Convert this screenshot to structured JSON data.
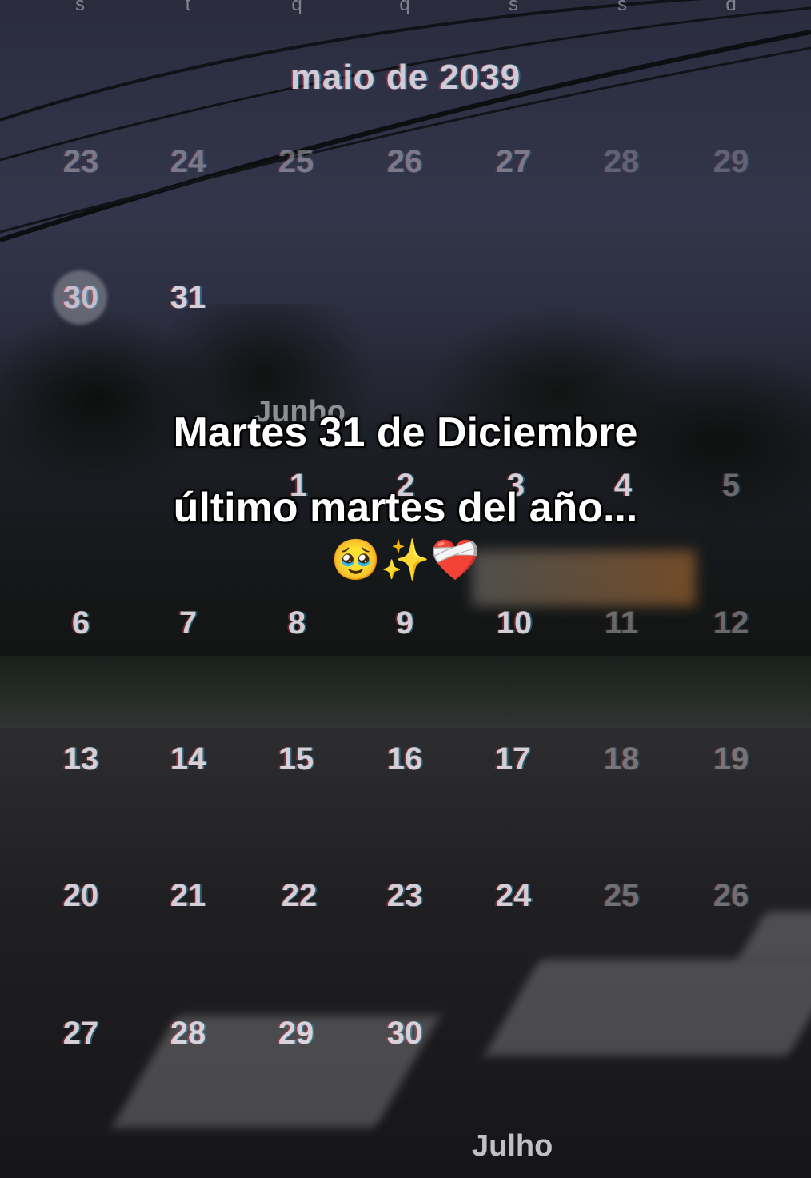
{
  "calendar": {
    "weekdays": [
      "s",
      "t",
      "q",
      "q",
      "s",
      "s",
      "d"
    ],
    "month_title": "maio de 2039",
    "row_prev": [
      "23",
      "24",
      "25",
      "26",
      "27",
      "28",
      "29"
    ],
    "row_selected_day": "30",
    "row_31": "31",
    "month2_label": "Junho",
    "week1": [
      "1",
      "2",
      "3",
      "4",
      "5"
    ],
    "week2": [
      "6",
      "7",
      "8",
      "9",
      "10",
      "11",
      "12"
    ],
    "week3": [
      "13",
      "14",
      "15",
      "16",
      "17",
      "18",
      "19"
    ],
    "week4": [
      "20",
      "21",
      "22",
      "23",
      "24",
      "25",
      "26"
    ],
    "week5": [
      "27",
      "28",
      "29",
      "30"
    ],
    "month3_label": "Julho"
  },
  "caption": {
    "line1": "Martes 31 de Diciembre",
    "line2": "último martes del año..."
  },
  "emojis": [
    "🥹",
    "✨",
    "❤️‍🩹"
  ],
  "colors": {
    "caption_text": "#ffffff",
    "calendar_text": "#ebebf0"
  }
}
